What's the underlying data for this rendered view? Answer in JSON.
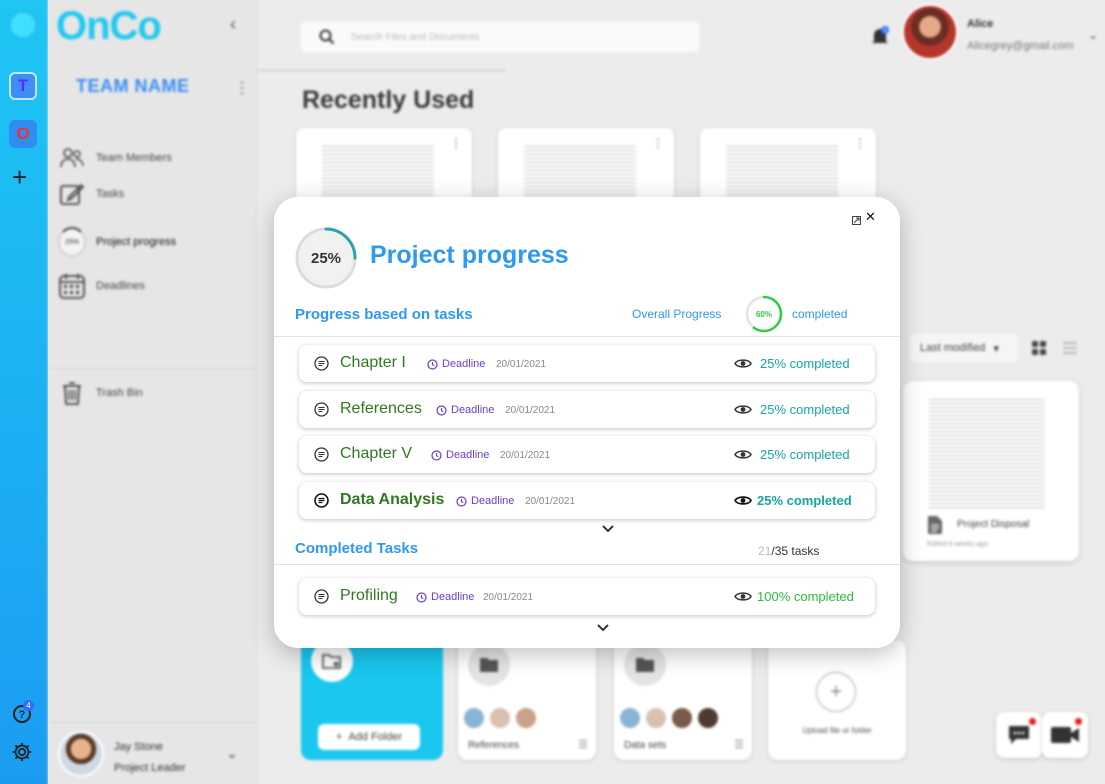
{
  "app": {
    "logo": "OnCo",
    "rail": {
      "app_t": "T",
      "app_o": "O",
      "help_badge": "4"
    }
  },
  "sidebar": {
    "team_name": "TEAM NAME",
    "items": [
      {
        "label": "Team Members",
        "icon": "people-icon"
      },
      {
        "label": "Tasks",
        "icon": "edit-icon"
      },
      {
        "label": "Project progress",
        "icon": "progress-ring-icon",
        "ring_value": "25%"
      },
      {
        "label": "Deadlines",
        "icon": "calendar-icon"
      },
      {
        "label": "Trash Bin",
        "icon": "trash-icon"
      }
    ],
    "profile": {
      "name": "Jay Stone",
      "role": "Project Leader"
    }
  },
  "header": {
    "search_placeholder": "Search Files and Documents",
    "notification_count": "0",
    "user": {
      "name": "Alice",
      "email": "Alicegrey@gmail.com"
    }
  },
  "main": {
    "recent_title": "Recently Used",
    "sort_label": "Last modified",
    "file_card": {
      "name": "Project Disposal",
      "sub": "Edited 6 weeks ago"
    },
    "add_folder_label": "Add Folder",
    "folders": [
      {
        "label": "References"
      },
      {
        "label": "Data sets"
      }
    ],
    "upload_label": "Upload file or folder"
  },
  "modal": {
    "ring_value": "25%",
    "ring_fraction": 0.25,
    "title": "Project progress",
    "progress_section": "Progress based on tasks",
    "overall_label": "Overall Progress",
    "overall_value": "60%",
    "overall_fraction": 0.6,
    "overall_completed": "completed",
    "deadline_label": "Deadline",
    "tasks": [
      {
        "name": "Chapter I",
        "date": "20/01/2021",
        "progress": "25% completed"
      },
      {
        "name": "References",
        "date": "20/01/2021",
        "progress": "25% completed"
      },
      {
        "name": "Chapter V",
        "date": "20/01/2021",
        "progress": "25% completed"
      },
      {
        "name": "Data Analysis",
        "date": "20/01/2021",
        "progress": "25% completed"
      }
    ],
    "completed_section": "Completed Tasks",
    "completed_count": "21",
    "completed_total": "/35 tasks",
    "completed_tasks": [
      {
        "name": "Profiling",
        "date": "20/01/2021",
        "progress": "100% completed"
      }
    ]
  },
  "colors": {
    "accent": "#2f98f0",
    "task_name": "#2f7a1f",
    "deadline": "#6b3ec9",
    "progress_teal": "#17a6a0",
    "progress_green": "#2cbf3a",
    "rail_top": "#1ec6f4",
    "rail_bottom": "#1b9cf2"
  }
}
